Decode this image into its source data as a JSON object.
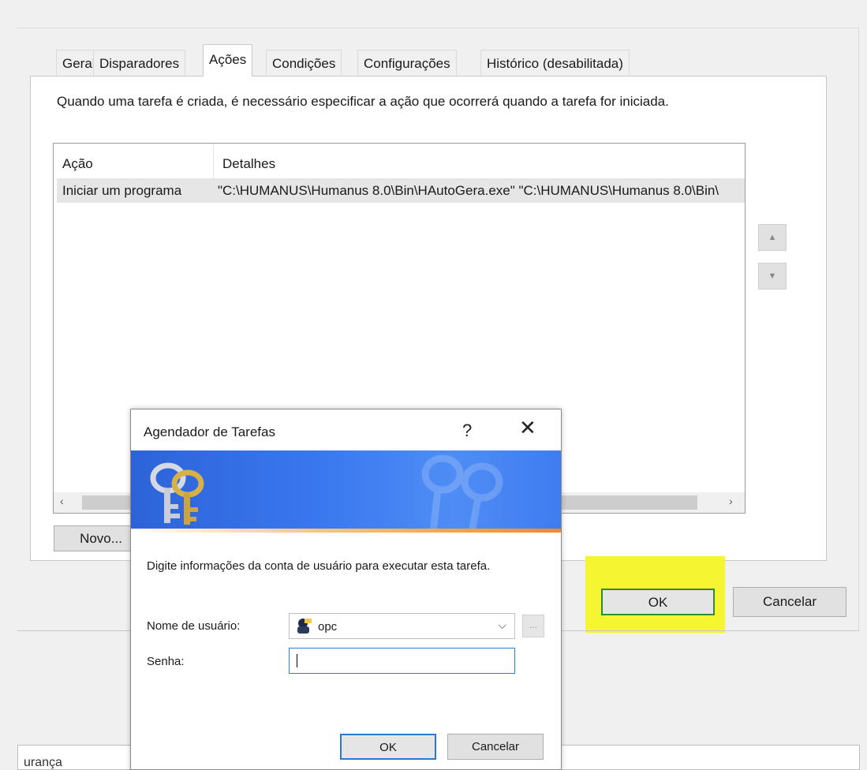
{
  "tabs": [
    {
      "label": "Geral"
    },
    {
      "label": "Disparadores"
    },
    {
      "label": "Ações"
    },
    {
      "label": "Condições"
    },
    {
      "label": "Configurações"
    },
    {
      "label": "Histórico (desabilitada)"
    }
  ],
  "panel": {
    "description": "Quando uma tarefa é criada, é necessário especificar a ação que ocorrerá quando a tarefa for iniciada.",
    "list": {
      "columns": [
        "Ação",
        "Detalhes"
      ],
      "rows": [
        {
          "action": "Iniciar um programa",
          "details": "\"C:\\HUMANUS\\Humanus 8.0\\Bin\\HAutoGera.exe\" \"C:\\HUMANUS\\Humanus 8.0\\Bin\\"
        }
      ]
    },
    "new_button": "Novo..."
  },
  "footer": {
    "ok_label": "OK",
    "cancel_label": "Cancelar",
    "clipped_label": "urança",
    "highlight_color": "#f5f531"
  },
  "dialog": {
    "title": "Agendador de Tarefas",
    "help_glyph": "?",
    "close_glyph": "✕",
    "description": "Digite informações da conta de usuário para executar esta tarefa.",
    "username_label": "Nome de usuário:",
    "username_value": "opc",
    "password_label": "Senha:",
    "password_value": "",
    "browse_label": "...",
    "ok_label": "OK",
    "cancel_label": "Cancelar",
    "banner_color": "#3a78f0"
  },
  "icons": {
    "scroll_up": "▲",
    "scroll_down": "▼",
    "scroll_left": "‹",
    "scroll_right": "›",
    "combo_chevron": "⌵"
  }
}
